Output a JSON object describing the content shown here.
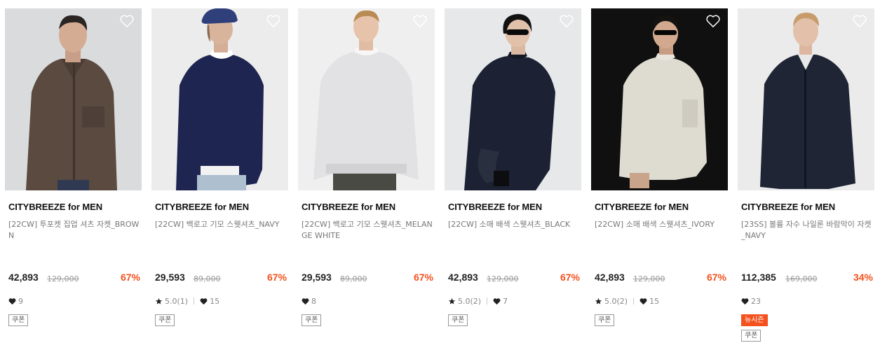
{
  "colors": {
    "discount": "#f4511e",
    "new_season_badge": "#f4511e"
  },
  "icons": {
    "wishlist": "heart-outline-icon",
    "rating": "star-icon",
    "likes": "heart-filled-icon"
  },
  "products": [
    {
      "brand": "CITYBREEZE for MEN",
      "name": "[22CW] 투포켓 집업 셔츠 자켓_BROWN",
      "price": "42,893",
      "original_price": "129,000",
      "discount": "67%",
      "rating": null,
      "likes": "9",
      "badges": [],
      "coupon": "쿠폰"
    },
    {
      "brand": "CITYBREEZE for MEN",
      "name": "[22CW] 백로고 기모 스웻셔츠_NAVY",
      "price": "29,593",
      "original_price": "89,000",
      "discount": "67%",
      "rating": "5.0(1)",
      "likes": "15",
      "badges": [],
      "coupon": "쿠폰"
    },
    {
      "brand": "CITYBREEZE for MEN",
      "name": "[22CW] 백로고 기모 스웻셔츠_MELANGE WHITE",
      "price": "29,593",
      "original_price": "89,000",
      "discount": "67%",
      "rating": null,
      "likes": "8",
      "badges": [],
      "coupon": "쿠폰"
    },
    {
      "brand": "CITYBREEZE for MEN",
      "name": "[22CW] 소매 배색 스웻셔츠_BLACK",
      "price": "42,893",
      "original_price": "129,000",
      "discount": "67%",
      "rating": "5.0(2)",
      "likes": "7",
      "badges": [],
      "coupon": "쿠폰"
    },
    {
      "brand": "CITYBREEZE for MEN",
      "name": "[22CW] 소매 배색 스웻셔츠_IVORY",
      "price": "42,893",
      "original_price": "129,000",
      "discount": "67%",
      "rating": "5.0(2)",
      "likes": "15",
      "badges": [],
      "coupon": "쿠폰"
    },
    {
      "brand": "CITYBREEZE for MEN",
      "name": "[23SS] 볼륨 자수 나일론 바람막이 자켓_NAVY",
      "price": "112,385",
      "original_price": "169,000",
      "discount": "34%",
      "rating": null,
      "likes": "23",
      "badges": [
        "뉴시즌"
      ],
      "coupon": "쿠폰"
    }
  ]
}
